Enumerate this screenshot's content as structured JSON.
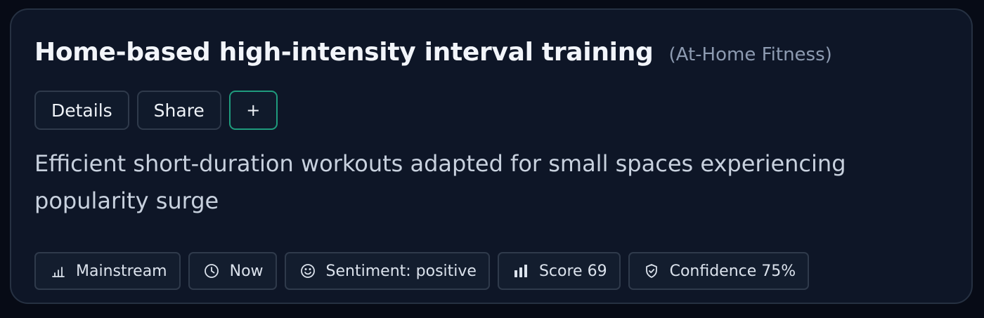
{
  "trend": {
    "title": "Home-based high-intensity interval training",
    "category": "(At-Home Fitness)",
    "description": "Efficient short-duration workouts adapted for small spaces experiencing popularity surge"
  },
  "actions": {
    "details_label": "Details",
    "share_label": "Share",
    "add_label": "+"
  },
  "tags": [
    {
      "icon": "bar-chart-outline-icon",
      "label": "Mainstream"
    },
    {
      "icon": "clock-icon",
      "label": "Now"
    },
    {
      "icon": "smile-icon",
      "label": "Sentiment: positive"
    },
    {
      "icon": "bar-chart-filled-icon",
      "label": "Score 69"
    },
    {
      "icon": "shield-check-icon",
      "label": "Confidence 75%"
    }
  ],
  "colors": {
    "background": "#070b16",
    "card": "#0e1627",
    "border": "#263142",
    "accent": "#1f9b7d",
    "title": "#f2f5fa",
    "muted": "#8d9bb1"
  }
}
